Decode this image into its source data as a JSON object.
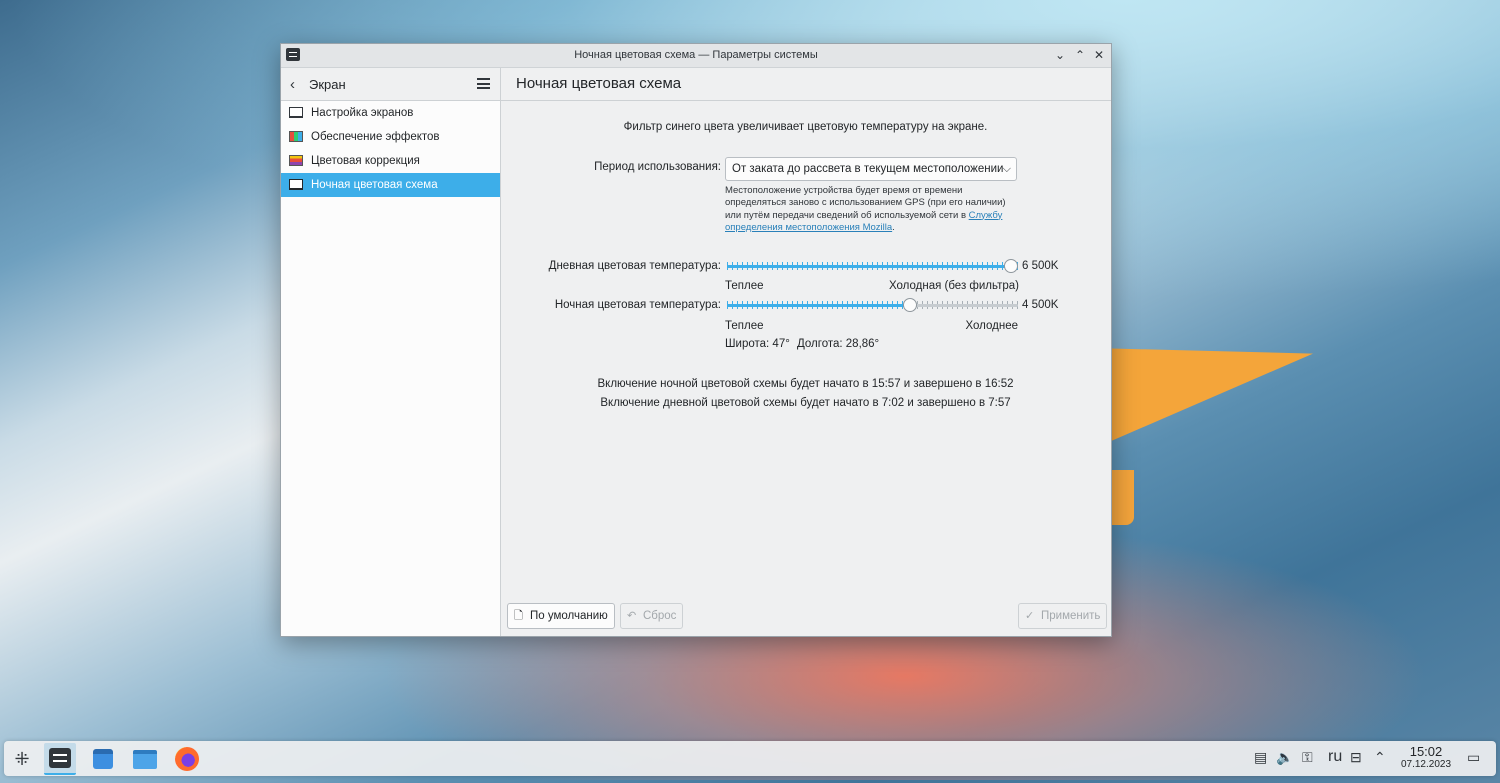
{
  "window": {
    "title": "Ночная цветовая схема — Параметры системы",
    "controls": {
      "minimize": "⌄",
      "maximize": "⌃",
      "close": "✕"
    }
  },
  "sidebar": {
    "header": "Экран",
    "items": [
      {
        "label": "Настройка экранов",
        "icon": "monitor-icon"
      },
      {
        "label": "Обеспечение эффектов",
        "icon": "effects-icon"
      },
      {
        "label": "Цветовая коррекция",
        "icon": "color-correction-icon"
      },
      {
        "label": "Ночная цветовая схема",
        "icon": "monitor-icon",
        "active": true
      }
    ]
  },
  "main": {
    "title": "Ночная цветовая схема",
    "intro": "Фильтр синего цвета увеличивает цветовую температуру на экране.",
    "period_label": "Период использования:",
    "period_value": "От заката до рассвета в текущем местоположении",
    "note_text": "Местоположение устройства будет время от времени определяться заново с использованием GPS (при его наличии) или путём передачи сведений об используемой сети в ",
    "note_link": "Службу определения местоположения Mozilla",
    "note_end": ".",
    "day_label": "Дневная цветовая температура:",
    "day_value": "6 500K",
    "day_level": 1.0,
    "day_min_label": "Теплее",
    "day_max_label": "Холодная (без фильтра)",
    "night_label": "Ночная цветовая температура:",
    "night_value": "4 500K",
    "night_level": 0.63,
    "night_min_label": "Теплее",
    "night_max_label": "Холоднее",
    "latitude": "Широта: 47°",
    "longitude": "Долгота: 28,86°",
    "night_schedule": "Включение ночной цветовой схемы будет начато в 15:57 и завершено в 16:52",
    "day_schedule": "Включение дневной цветовой схемы будет начато в 7:02 и завершено в 7:57"
  },
  "footer": {
    "defaults": "По умолчанию",
    "reset": "Сброс",
    "apply": "Применить"
  },
  "taskbar": {
    "lang": "ru",
    "time": "15:02",
    "date": "07.12.2023"
  },
  "colors": {
    "accent": "#3daee9",
    "window_bg": "#eff0f1"
  }
}
